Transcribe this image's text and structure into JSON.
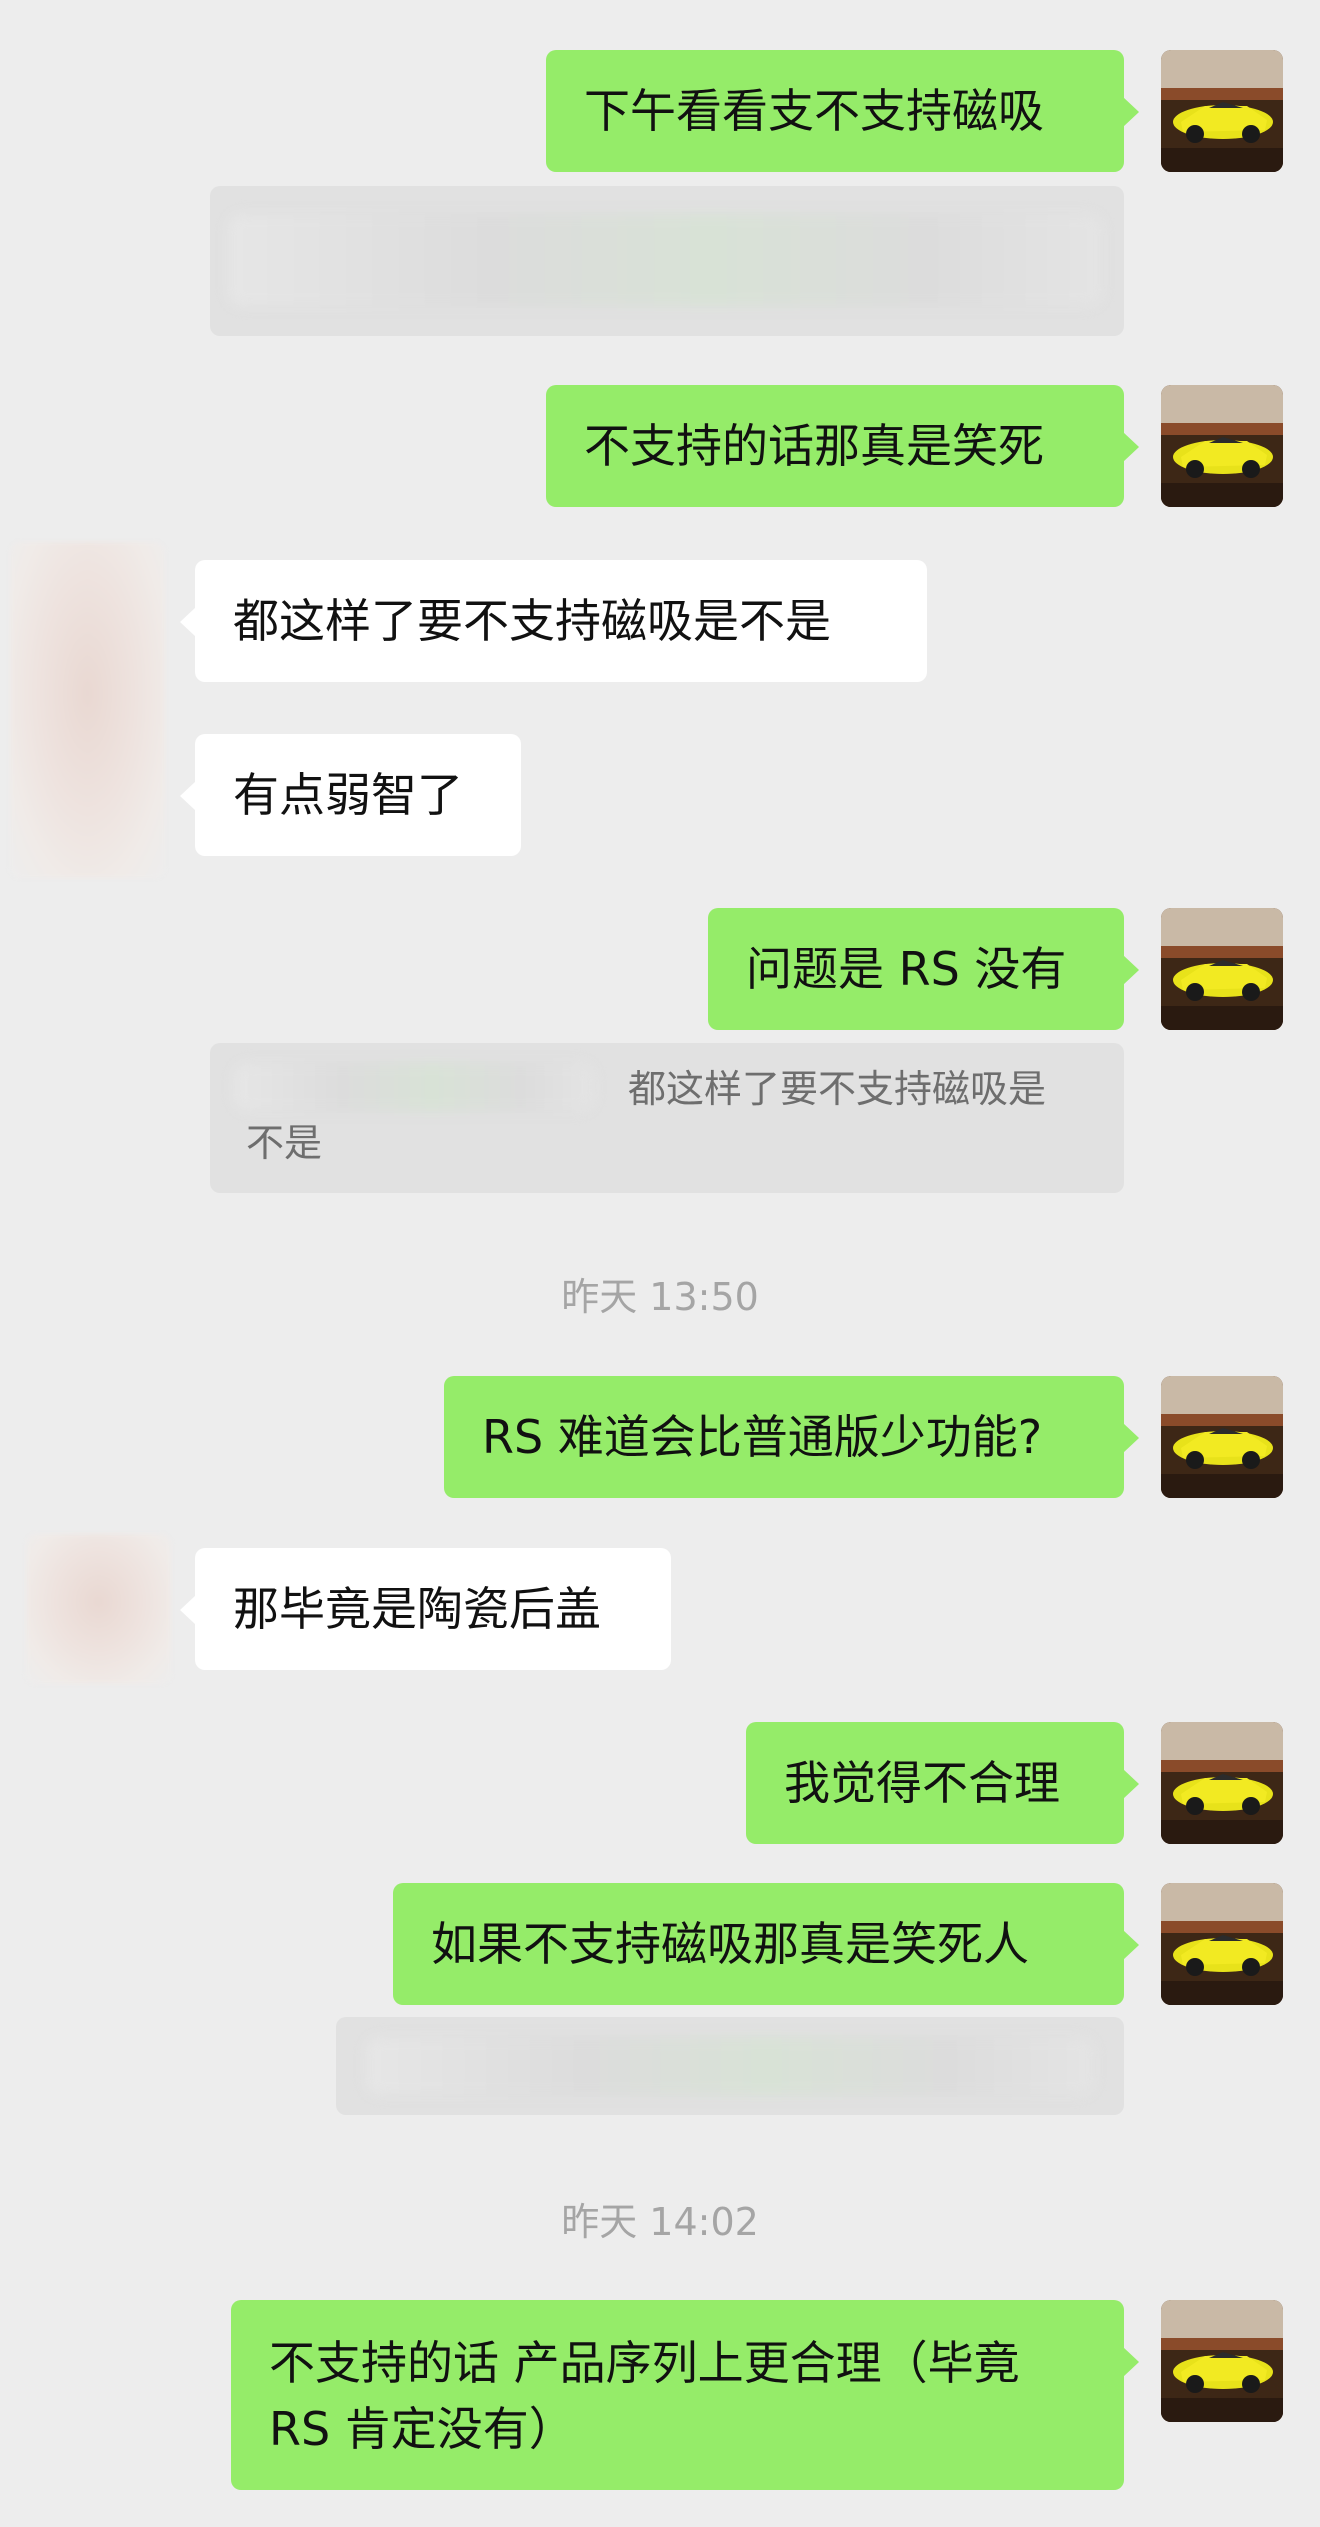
{
  "chat": {
    "messages": {
      "m1": "下午看看支不支持磁吸",
      "m2": "不支持的话那真是笑死",
      "m3": "都这样了要不支持磁吸是不是",
      "m4": "有点弱智了",
      "m5": "问题是 RS 没有",
      "m6": "RS 难道会比普通版少功能?",
      "m7": "那毕竟是陶瓷后盖",
      "m8": "我觉得不合理",
      "m9": "如果不支持磁吸那真是笑死人",
      "m10_line1": "不支持的话 产品序列上更合理（毕竟",
      "m10_line2": "RS 肯定没有）"
    },
    "quotes": {
      "q2_line1": "都这样了要不支持磁吸是",
      "q2_line2": "不是"
    },
    "timestamps": {
      "t1": "昨天 13:50",
      "t2": "昨天 14:02"
    }
  },
  "theme": {
    "background": "#ededed",
    "my_bubble": "#95ec69",
    "their_bubble": "#ffffff",
    "quote_box": "#e1e1e1"
  },
  "icons": {
    "my_avatar": "yellow-sports-car-avatar",
    "their_avatar": "blurred-avatar"
  }
}
